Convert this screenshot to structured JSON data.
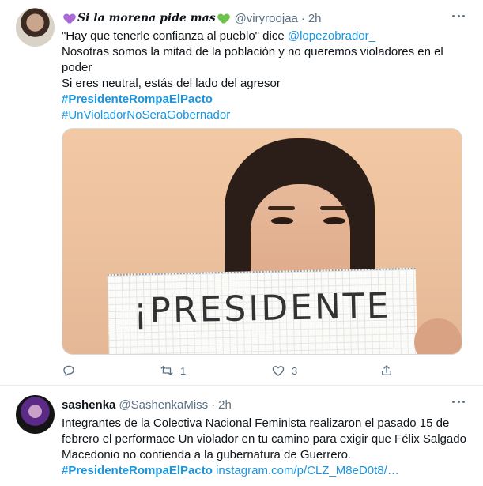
{
  "tweets": [
    {
      "display_name": "Si la morena pide mas",
      "handle": "@viryroojaa",
      "separator": "·",
      "time": "2h",
      "lines": [
        {
          "segments": [
            {
              "text": "\"Hay que tenerle confianza al pueblo\" dice ",
              "type": "text"
            },
            {
              "text": "@lopezobrador_",
              "type": "mention"
            }
          ]
        },
        {
          "segments": [
            {
              "text": "Nosotras somos la mitad de la población y no queremos violadores en el poder",
              "type": "text"
            }
          ]
        },
        {
          "segments": [
            {
              "text": "Si eres neutral, estás del lado del agresor",
              "type": "text"
            }
          ]
        },
        {
          "segments": [
            {
              "text": "#PresidenteRompaElPacto",
              "type": "hashtag-bold"
            }
          ]
        },
        {
          "segments": [
            {
              "text": "#UnVioladorNoSeraGobernador",
              "type": "hashtag"
            }
          ]
        }
      ],
      "media": {
        "sign_text": "¡PRESIDENTE"
      },
      "actions": {
        "reply_count": "",
        "retweet_count": "1",
        "like_count": "3"
      }
    },
    {
      "display_name": "sashenka",
      "handle": "@SashenkaMiss",
      "separator": "·",
      "time": "2h",
      "body_text": "Integrantes de la Colectiva Nacional Feminista realizaron el pasado 15 de febrero el performace Un violador en tu camino para exigir que Félix Salgado Macedonio no contienda a la gubernatura de Guerrero.",
      "hashtag": "#PresidenteRompaElPacto",
      "link": "instagram.com/p/CLZ_M8eD0t8/…"
    }
  ],
  "icons": {
    "name_prefix": "purple-heart-icon",
    "name_suffix": "green-heart-icon",
    "more": "more-dots-icon",
    "reply": "reply-icon",
    "retweet": "retweet-icon",
    "like": "like-icon",
    "share": "share-icon"
  },
  "colors": {
    "link": "#1b95e0",
    "secondary_text": "#5b7083",
    "divider": "#e6ecf0"
  }
}
